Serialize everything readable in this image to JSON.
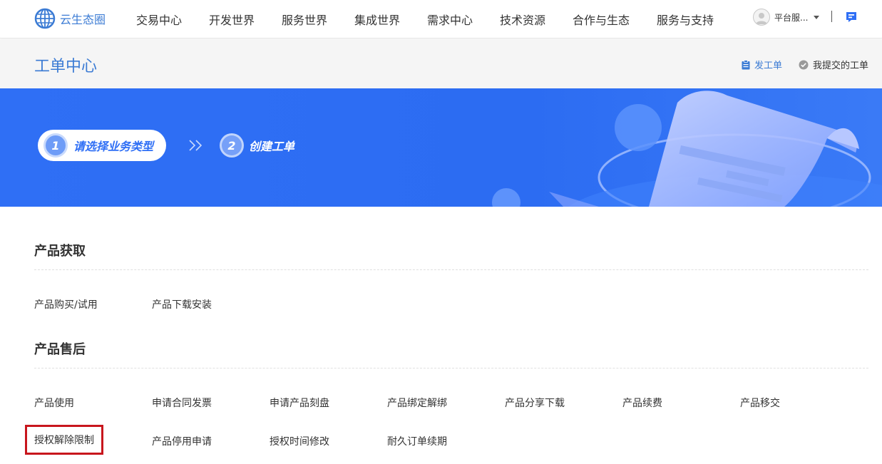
{
  "header": {
    "brand": "云生态圈",
    "nav": [
      "交易中心",
      "开发世界",
      "服务世界",
      "集成世界",
      "需求中心",
      "技术资源",
      "合作与生态",
      "服务与支持"
    ],
    "user": "平台服...",
    "icons": [
      "globe-logo-icon",
      "user-avatar-icon",
      "chevron-down-icon",
      "message-icon"
    ]
  },
  "subheader": {
    "title": "工单中心",
    "new_ticket": "发工单",
    "my_tickets": "我提交的工单"
  },
  "banner": {
    "step1_num": "1",
    "step1_label": "请选择业务类型",
    "step2_num": "2",
    "step2_label": "创建工单",
    "accent": "#2f6ff5"
  },
  "sections": [
    {
      "title": "产品获取",
      "items": [
        "产品购买/试用",
        "产品下载安装"
      ]
    },
    {
      "title": "产品售后",
      "items": [
        "产品使用",
        "申请合同发票",
        "申请产品刻盘",
        "产品绑定解绑",
        "产品分享下载",
        "产品续费",
        "产品移交",
        "授权解除限制",
        "产品停用申请",
        "授权时间修改",
        "耐久订单续期"
      ]
    }
  ],
  "highlight_color": "#c8161d"
}
